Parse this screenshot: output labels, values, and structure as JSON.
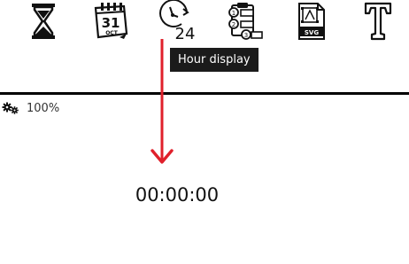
{
  "toolbar": {
    "items": [
      {
        "icon": "hourglass-icon"
      },
      {
        "icon": "calendar-icon",
        "day": "31",
        "month": "OCT"
      },
      {
        "icon": "clock-24-icon",
        "number": "24"
      },
      {
        "icon": "clipboard-checklist-icon",
        "numbers": [
          "1",
          "2",
          "3"
        ]
      },
      {
        "icon": "svg-file-icon",
        "label": "SVG"
      },
      {
        "icon": "text-tool-icon",
        "glyph": "T"
      }
    ]
  },
  "tooltip": {
    "text": "Hour display"
  },
  "status": {
    "zoom": "100%",
    "icon": "gears-icon"
  },
  "display": {
    "time": "00:00:00"
  },
  "annotation": {
    "color": "#e0202b",
    "icon": "arrow-down-icon"
  }
}
